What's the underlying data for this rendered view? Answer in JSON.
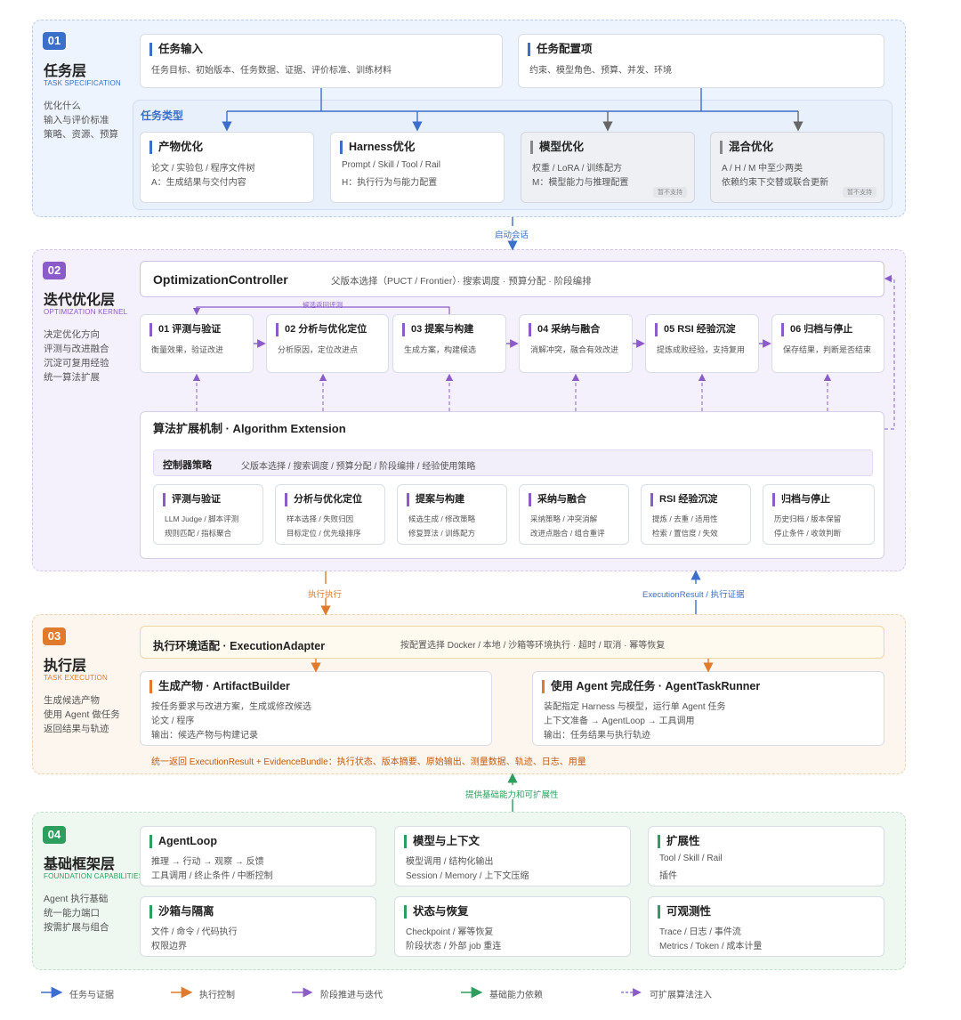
{
  "layer1": {
    "num": "01",
    "title": "任务层",
    "subtitle": "TASK SPECIFICATION",
    "desc": [
      "优化什么",
      "输入与评价标准",
      "策略、资源、预算"
    ],
    "input": {
      "title": "任务输入",
      "line": "任务目标、初始版本、任务数据、证据、评价标准、训练材料"
    },
    "config": {
      "title": "任务配置项",
      "line": "约束、模型角色、预算、并发、环境"
    },
    "types_label": "任务类型",
    "types": [
      {
        "title": "产物优化",
        "l1": "论文 / 实验包 / 程序文件树",
        "l2": "A：生成结果与交付内容",
        "tag": ""
      },
      {
        "title": "Harness优化",
        "l1": "Prompt / Skill / Tool / Rail",
        "l2": "H：执行行为与能力配置",
        "tag": ""
      },
      {
        "title": "模型优化",
        "l1": "权重 / LoRA / 训练配方",
        "l2": "M：模型能力与推理配置",
        "tag": "暂不支持"
      },
      {
        "title": "混合优化",
        "l1": "A / H / M 中至少两类",
        "l2": "依赖约束下交替或联合更新",
        "tag": "暂不支持"
      }
    ]
  },
  "conn12": "启动会话",
  "layer2": {
    "num": "02",
    "title": "迭代优化层",
    "subtitle": "OPTIMIZATION KERNEL",
    "desc": [
      "决定优化方向",
      "评测与改进融合",
      "沉淀可复用经验",
      "统一算法扩展"
    ],
    "controller": {
      "title": "OptimizationController",
      "desc": "父版本选择（PUCT / Frontier）· 搜索调度 · 预算分配 · 阶段编排"
    },
    "feedback": "候选返回评测",
    "stages": [
      {
        "title": "01 评测与验证",
        "desc": "衡量效果，验证改进"
      },
      {
        "title": "02 分析与优化定位",
        "desc": "分析原因，定位改进点"
      },
      {
        "title": "03 提案与构建",
        "desc": "生成方案，构建候选"
      },
      {
        "title": "04 采纳与融合",
        "desc": "消解冲突，融合有效改进"
      },
      {
        "title": "05 RSI 经验沉淀",
        "desc": "提炼成败经验，支持复用"
      },
      {
        "title": "06 归档与停止",
        "desc": "保存结果，判断是否结束"
      }
    ],
    "ext": {
      "title": "算法扩展机制 · Algorithm Extension",
      "strategy_label": "控制器策略",
      "strategy_desc": "父版本选择 / 搜索调度 / 预算分配 / 阶段编排 / 经验使用策略",
      "modules": [
        {
          "title": "评测与验证",
          "l1": "LLM Judge / 脚本评测",
          "l2": "规则匹配 / 指标聚合"
        },
        {
          "title": "分析与优化定位",
          "l1": "样本选择 / 失败归因",
          "l2": "目标定位 / 优先级排序"
        },
        {
          "title": "提案与构建",
          "l1": "候选生成 / 修改策略",
          "l2": "修复算法 / 训练配方"
        },
        {
          "title": "采纳与融合",
          "l1": "采纳策略 / 冲突消解",
          "l2": "改进点融合 / 组合重评"
        },
        {
          "title": "RSI 经验沉淀",
          "l1": "提炼 / 去重 / 适用性",
          "l2": "检索 / 置信度 / 失效"
        },
        {
          "title": "归档与停止",
          "l1": "历史归档 / 版本保留",
          "l2": "停止条件 / 收敛判断"
        }
      ]
    }
  },
  "conn23_left": "执行执行",
  "conn23_right": "ExecutionResult / 执行证据",
  "layer3": {
    "num": "03",
    "title": "执行层",
    "subtitle": "TASK EXECUTION",
    "desc": [
      "生成候选产物",
      "使用 Agent 做任务",
      "返回结果与轨迹"
    ],
    "adapter": {
      "title": "执行环境适配 · ExecutionAdapter",
      "desc": "按配置选择 Docker / 本地 / 沙箱等环境执行 · 超时 / 取消 · 幂等恢复"
    },
    "builder": {
      "title": "生成产物 · ArtifactBuilder",
      "l1": "按任务要求与改进方案，生成或修改候选",
      "l2": "论文 / 程序",
      "l3": "输出：候选产物与构建记录"
    },
    "runner": {
      "title": "使用 Agent 完成任务 · AgentTaskRunner",
      "l1": "装配指定 Harness 与模型，运行单 Agent 任务",
      "l2": "上下文准备 → AgentLoop → 工具调用",
      "l3": "输出：任务结果与执行轨迹"
    },
    "footer": "统一返回 ExecutionResult + EvidenceBundle：执行状态、版本摘要、原始输出、测量数据、轨迹、日志、用量"
  },
  "conn34": "提供基础能力和可扩展性",
  "layer4": {
    "num": "04",
    "title": "基础框架层",
    "subtitle": "FOUNDATION CAPABILITIES",
    "desc": [
      "Agent 执行基础",
      "统一能力端口",
      "按需扩展与组合"
    ],
    "cards": [
      {
        "title": "AgentLoop",
        "l1": "推理 → 行动 → 观察 → 反馈",
        "l2": "工具调用 / 终止条件 / 中断控制"
      },
      {
        "title": "模型与上下文",
        "l1": "模型调用 / 结构化输出",
        "l2": "Session / Memory / 上下文压缩"
      },
      {
        "title": "扩展性",
        "l1": "Tool / Skill / Rail",
        "l2": "插件"
      },
      {
        "title": "沙箱与隔离",
        "l1": "文件 / 命令 / 代码执行",
        "l2": "权限边界"
      },
      {
        "title": "状态与恢复",
        "l1": "Checkpoint / 幂等恢复",
        "l2": "阶段状态 / 外部 job 重连"
      },
      {
        "title": "可观测性",
        "l1": "Trace / 日志 / 事件流",
        "l2": "Metrics / Token / 成本计量"
      }
    ]
  },
  "legend": [
    {
      "label": "任务与证据",
      "color": "#3b6fc9"
    },
    {
      "label": "执行控制",
      "color": "#e07b2e"
    },
    {
      "label": "阶段推进与迭代",
      "color": "#8b5cc9"
    },
    {
      "label": "基础能力依赖",
      "color": "#2e9e5e"
    },
    {
      "label": "可扩展算法注入",
      "color": "#9b7bcc"
    }
  ],
  "colors": {
    "blue": "#3b6fc9",
    "purple": "#8b5cc9",
    "orange": "#e07b2e",
    "green": "#2e9e5e"
  }
}
